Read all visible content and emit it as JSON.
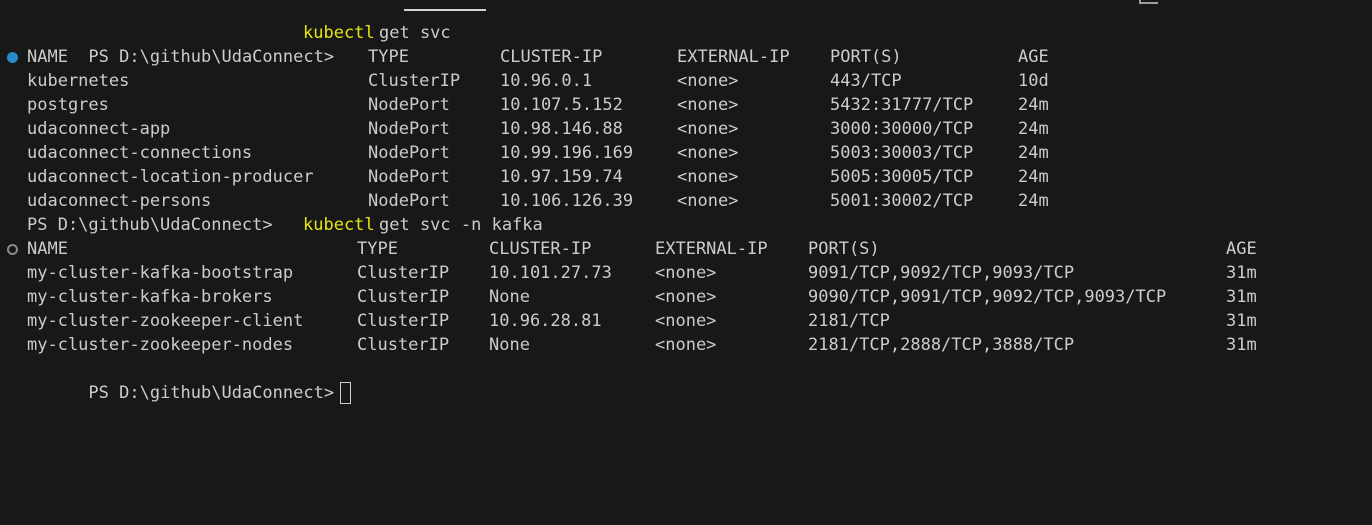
{
  "terminal": {
    "prompt": "PS D:\\github\\UdaConnect>",
    "commands": [
      {
        "program": "kubectl",
        "args": "get svc"
      },
      {
        "program": "kubectl",
        "args": "get svc -n kafka"
      }
    ]
  },
  "table1": {
    "headers": [
      "NAME",
      "TYPE",
      "CLUSTER-IP",
      "EXTERNAL-IP",
      "PORT(S)",
      "AGE"
    ],
    "rows": [
      [
        "kubernetes",
        "ClusterIP",
        "10.96.0.1",
        "<none>",
        "443/TCP",
        "10d"
      ],
      [
        "postgres",
        "NodePort",
        "10.107.5.152",
        "<none>",
        "5432:31777/TCP",
        "24m"
      ],
      [
        "udaconnect-app",
        "NodePort",
        "10.98.146.88",
        "<none>",
        "3000:30000/TCP",
        "24m"
      ],
      [
        "udaconnect-connections",
        "NodePort",
        "10.99.196.169",
        "<none>",
        "5003:30003/TCP",
        "24m"
      ],
      [
        "udaconnect-location-producer",
        "NodePort",
        "10.97.159.74",
        "<none>",
        "5005:30005/TCP",
        "24m"
      ],
      [
        "udaconnect-persons",
        "NodePort",
        "10.106.126.39",
        "<none>",
        "5001:30002/TCP",
        "24m"
      ]
    ]
  },
  "table2": {
    "headers": [
      "NAME",
      "TYPE",
      "CLUSTER-IP",
      "EXTERNAL-IP",
      "PORT(S)",
      "AGE"
    ],
    "rows": [
      [
        "my-cluster-kafka-bootstrap",
        "ClusterIP",
        "10.101.27.73",
        "<none>",
        "9091/TCP,9092/TCP,9093/TCP",
        "31m"
      ],
      [
        "my-cluster-kafka-brokers",
        "ClusterIP",
        "None",
        "<none>",
        "9090/TCP,9091/TCP,9092/TCP,9093/TCP",
        "31m"
      ],
      [
        "my-cluster-zookeeper-client",
        "ClusterIP",
        "10.96.28.81",
        "<none>",
        "2181/TCP",
        "31m"
      ],
      [
        "my-cluster-zookeeper-nodes",
        "ClusterIP",
        "None",
        "<none>",
        "2181/TCP,2888/TCP,3888/TCP",
        "31m"
      ]
    ]
  },
  "colors": {
    "background": "#181818",
    "text": "#cccccc",
    "command": "#e5e510",
    "decoration_success": "#2a89c8",
    "decoration_default": "#8a8a8a"
  }
}
